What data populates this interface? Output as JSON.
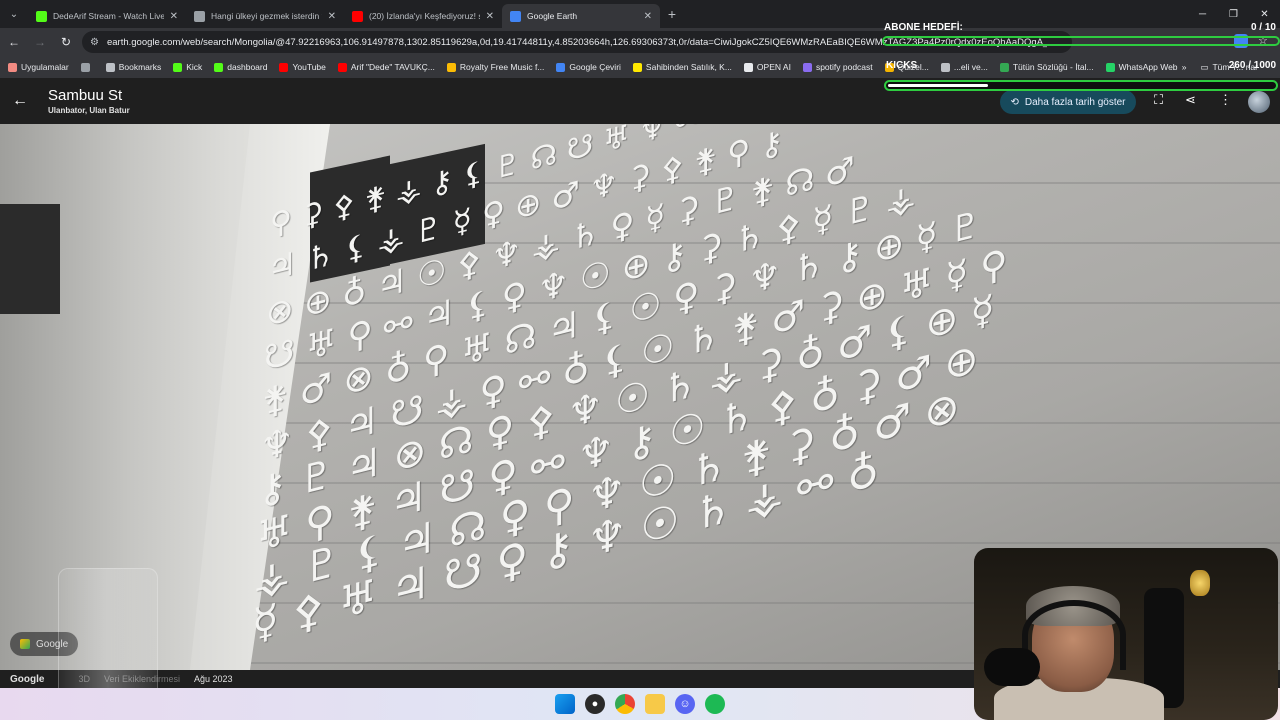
{
  "tabs": [
    {
      "title": "DedeArif Stream - Watch Live o",
      "color": "#53fc18",
      "active": false
    },
    {
      "title": "Hangi ülkeyi gezmek isterdin ?",
      "color": "#9aa0a6",
      "active": false
    },
    {
      "title": "(20) İzlanda'yı Keşfediyoruz! ss",
      "color": "#ff0000",
      "active": false
    },
    {
      "title": "Google Earth",
      "color": "#4285f4",
      "active": true
    }
  ],
  "address": {
    "url": "earth.google.com/web/search/Mongolia/@47.92216963,106.91497878,1302.85119629a,0d,19.41744811y,4.85203664h,126.69306373t,0r/data=CiwiJgokCZ5IQE6WMzRAEaBIQE6WMzTAGZ3Pa4Pz0rQdx0zEoQhAaDQgA_DJ6OgQIfw..."
  },
  "bookmarks": [
    {
      "label": "Uygulamalar",
      "color": "#f28b82"
    },
    {
      "label": "",
      "color": "#9aa0a6"
    },
    {
      "label": "Bookmarks",
      "color": "#bdc1c6"
    },
    {
      "label": "Kick",
      "color": "#53fc18"
    },
    {
      "label": "dashboard",
      "color": "#53fc18"
    },
    {
      "label": "YouTube",
      "color": "#ff0000"
    },
    {
      "label": "Arif \"Dede\" TAVUKÇ...",
      "color": "#ff0000"
    },
    {
      "label": "Royalty Free Music f...",
      "color": "#fbbc05"
    },
    {
      "label": "Google Çeviri",
      "color": "#4285f4"
    },
    {
      "label": "Sahibinden Satılık, K...",
      "color": "#ffe800"
    },
    {
      "label": "OPEN AI",
      "color": "#e8eaed"
    },
    {
      "label": "spotify podcast",
      "color": "#8a6cf0"
    },
    {
      "label": "Quizel...",
      "color": "#f4b400"
    },
    {
      "label": "...eli ve...",
      "color": "#bdc1c6"
    },
    {
      "label": "Tütün Sözlüğü - İtal...",
      "color": "#34a853"
    },
    {
      "label": "WhatsApp Web",
      "color": "#25d366"
    }
  ],
  "bookmarks_more": "»",
  "bookmarks_all": "Tüm Y... rlar",
  "earth": {
    "place_title": "Sambuu St",
    "place_subtitle": "Ulanbator, Ulan Batur",
    "history_button": "Daha fazla tarih göster",
    "google_chip": "Google",
    "bottom_logo": "Google",
    "bottom_3d": "3D",
    "bottom_data": "Veri Ekiklendirmesi",
    "bottom_date": "Ağu 2023"
  },
  "overlay": {
    "abone_title": "ABONE HEDEFİ:",
    "abone_count": "0 / 10",
    "abone_progress": 0,
    "kicks_title": "KICKS",
    "kicks_count": "260 / 1000",
    "kicks_progress": 0.26
  },
  "glyph_rows": [
    "⚲ ⚳ ⚴ ⚵ ⚶ ⚷ ⚸ ♇ ☊ ☋ ♅ ♆ ⚯",
    "♃ ♄ ⚸ ⚶ ♇ ☿ ♀ ⊕ ♂ ♆ ⚳ ⚴ ⚵ ⚲ ⚷",
    "⊗ ⊕ ♁ ♃ ☉ ⚴ ♆ ⚶ ♄ ♀ ☿ ⚳ ♇ ⚵ ☊ ♂",
    "☋ ♅ ⚲ ⚯ ♃ ⚸ ♀ ♆ ☉ ⊕ ⚷ ⚳ ♄ ⚴ ☿ ♇ ⚶",
    "⚵ ♂ ⊗ ♁ ⚲ ♅ ☊ ♃ ⚸ ☉ ♀ ⚳ ♆ ♄ ⚷ ⊕ ☿ ♇",
    "♆ ⚴ ♃ ☋ ⚶ ♀ ⚯ ♁ ⚸ ☉ ♄ ⚵ ♂ ⚳ ⊕ ♅ ☿ ⚲",
    "⚷ ♇ ♃ ⊗ ☊ ♀ ⚴ ♆ ☉ ♄ ⚶ ⚳ ♁ ♂ ⚸ ⊕ ☿",
    "♅ ⚲ ⚵ ♃ ☋ ♀ ⚯ ♆ ⚷ ☉ ♄ ⚴ ♁ ⚳ ♂ ⊕",
    "⚶ ♇ ⚸ ♃ ☊ ♀ ⚲ ♆ ☉ ♄ ⚵ ⚳ ♁ ♂ ⊗",
    "☿ ⚴ ♅ ♃ ☋ ♀ ⚷ ♆ ☉ ♄ ⚶ ⚯ ♁"
  ]
}
